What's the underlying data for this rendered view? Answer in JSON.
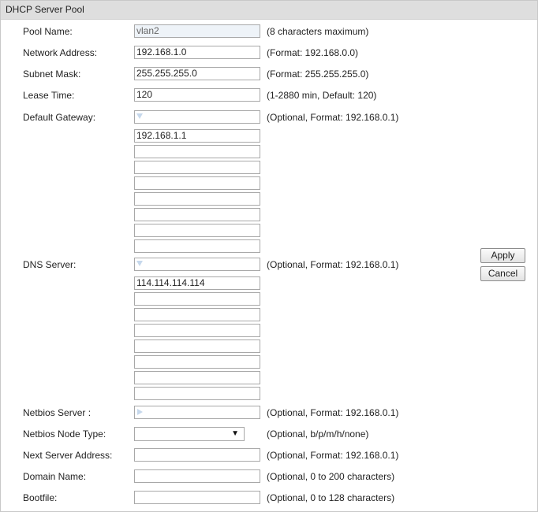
{
  "panel": {
    "title": "DHCP Server Pool"
  },
  "pool_name": {
    "label": "Pool Name:",
    "value": "vlan2",
    "hint": "(8 characters maximum)"
  },
  "network_address": {
    "label": "Network Address:",
    "value": "192.168.1.0",
    "hint": "(Format: 192.168.0.0)"
  },
  "subnet_mask": {
    "label": "Subnet Mask:",
    "value": "255.255.255.0",
    "hint": "(Format: 255.255.255.0)"
  },
  "lease_time": {
    "label": "Lease Time:",
    "value": "120",
    "hint": "(1-2880 min, Default: 120)"
  },
  "default_gateway": {
    "label": "Default Gateway:",
    "hint": "(Optional, Format: 192.168.0.1)",
    "entries": [
      "192.168.1.1",
      "",
      "",
      "",
      "",
      "",
      "",
      ""
    ]
  },
  "dns_server": {
    "label": "DNS Server:",
    "hint": "(Optional, Format: 192.168.0.1)",
    "entries": [
      "114.114.114.114",
      "",
      "",
      "",
      "",
      "",
      "",
      ""
    ]
  },
  "netbios_server": {
    "label": "Netbios Server :",
    "hint": "(Optional, Format: 192.168.0.1)"
  },
  "netbios_node_type": {
    "label": "Netbios Node Type:",
    "selected": "",
    "hint": "(Optional, b/p/m/h/none)"
  },
  "next_server_address": {
    "label": "Next Server Address:",
    "value": "",
    "hint": "(Optional, Format: 192.168.0.1)"
  },
  "domain_name": {
    "label": "Domain Name:",
    "value": "",
    "hint": "(Optional, 0 to 200 characters)"
  },
  "bootfile": {
    "label": "Bootfile:",
    "value": "",
    "hint": "(Optional, 0 to 128 characters)"
  },
  "buttons": {
    "apply": "Apply",
    "cancel": "Cancel"
  },
  "icons": {
    "dropdown_toggle": "triangle-down-icon",
    "expand_toggle": "triangle-right-icon",
    "select_caret": "caret-down-icon"
  }
}
